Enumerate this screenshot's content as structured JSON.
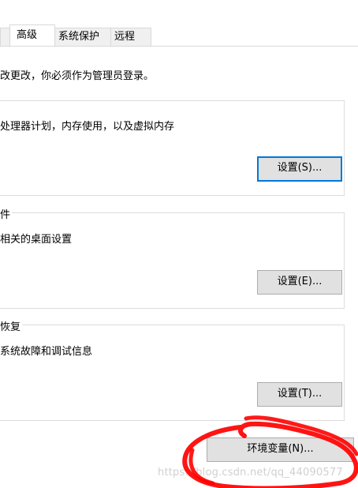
{
  "tabs": [
    "高级",
    "系统保护",
    "远程"
  ],
  "admin_notice": "改更改，你必须作为管理员登录。",
  "groups": [
    {
      "legend": "",
      "description": "处理器计划，内存使用，以及虚拟内存",
      "button": "设置(S)..."
    },
    {
      "legend": "件",
      "description": "相关的桌面设置",
      "button": "设置(E)..."
    },
    {
      "legend": "恢复",
      "description": "系统故障和调试信息",
      "button": "设置(T)..."
    }
  ],
  "env_button": "环境变量(N)...",
  "watermark": "https://blog.csdn.net/qq_44090577",
  "colors": {
    "annotation": "#ff0000",
    "focus": "#0078d7",
    "button_bg": "#e1e1e1"
  }
}
